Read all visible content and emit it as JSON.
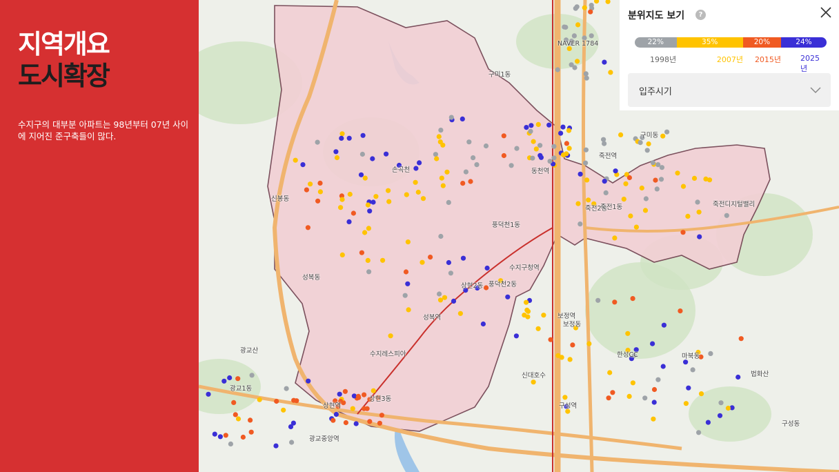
{
  "sidebar": {
    "title_line1": "지역개요",
    "title_line2": "도시확장",
    "description": "수지구의 대부분 아파트는 98년부터 07년 사이에 지어진 준구축들이 많다."
  },
  "legend": {
    "title": "분위지도 보기",
    "segments": [
      {
        "percent": 22,
        "label": "22%",
        "year": "1998년",
        "color": "#9ea3a8"
      },
      {
        "percent": 35,
        "label": "35%",
        "year": "2007년",
        "color": "#ffc300"
      },
      {
        "percent": 20,
        "label": "20%",
        "year": "2015년",
        "color": "#f05a22"
      },
      {
        "percent": 24,
        "label": "24%",
        "year": "2025년",
        "color": "#3a2fd6"
      }
    ],
    "filter_label": "입주시기"
  },
  "map": {
    "place_labels": [
      "신봉동",
      "성복동",
      "상현3동",
      "상현2동",
      "풍덕천1동",
      "풍덕천2동",
      "죽전2동",
      "죽전1동",
      "구미1동",
      "구미동",
      "구성동",
      "보정동",
      "마북동",
      "동천역",
      "성복역",
      "수지구청역",
      "죽전역",
      "보정역",
      "구성역",
      "광교산",
      "광교1동",
      "한성CC",
      "상현역",
      "신대호수",
      "죽전디지털밸리",
      "수지레스피아",
      "NAVER 1784",
      "광교중앙역",
      "손곡천",
      "법화산"
    ],
    "colors": {
      "boundary": "#6f3f4e",
      "district_fill": "#f2cfd4",
      "road": "#f0b46e",
      "rail": "#c9302c",
      "park": "#cfe3c3",
      "water": "#9fc5e8"
    }
  }
}
